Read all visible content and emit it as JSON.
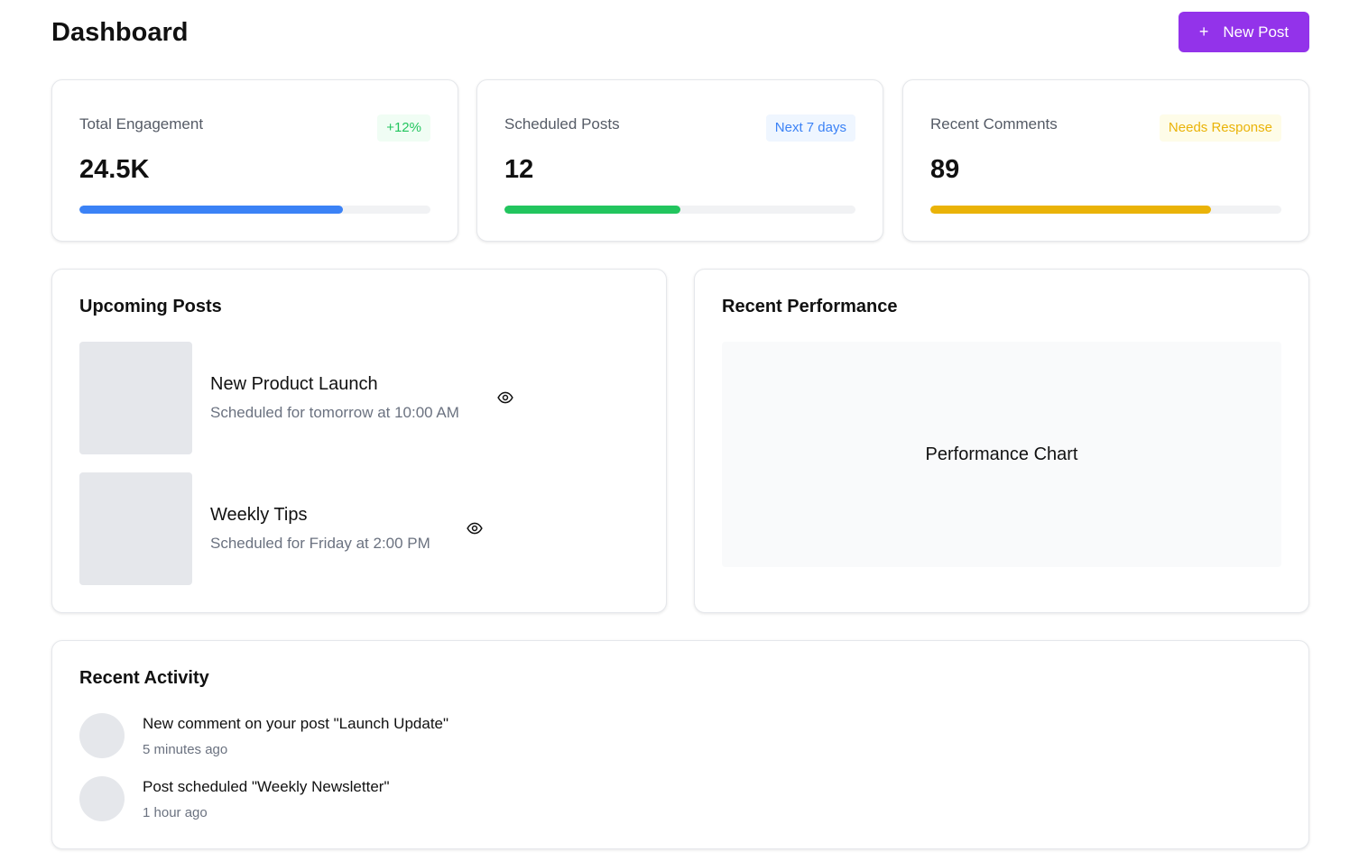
{
  "header": {
    "title": "Dashboard",
    "new_post_icon": "+",
    "new_post_label": "New Post"
  },
  "stats": [
    {
      "label": "Total Engagement",
      "badge": "+12%",
      "badge_color": "#22c55e",
      "badge_bg": "#f0fdf4",
      "value": "24.5K",
      "progress": 0.75,
      "bar_color": "#3b82f6"
    },
    {
      "label": "Scheduled Posts",
      "badge": "Next 7 days",
      "badge_color": "#3b82f6",
      "badge_bg": "#eff6ff",
      "value": "12",
      "progress": 0.5,
      "bar_color": "#22c55e"
    },
    {
      "label": "Recent Comments",
      "badge": "Needs Response",
      "badge_color": "#eab308",
      "badge_bg": "#fefce8",
      "value": "89",
      "progress": 0.8,
      "bar_color": "#eab308"
    }
  ],
  "upcoming": {
    "title": "Upcoming Posts",
    "posts": [
      {
        "title": "New Product Launch",
        "meta": "Scheduled for tomorrow at 10:00 AM",
        "icon": "eye-icon"
      },
      {
        "title": "Weekly Tips",
        "meta": "Scheduled for Friday at 2:00 PM",
        "icon": "eye-icon"
      }
    ]
  },
  "performance": {
    "title": "Recent Performance",
    "placeholder": "Performance Chart"
  },
  "activity": {
    "title": "Recent Activity",
    "items": [
      {
        "text": "New comment on your post \"Launch Update\"",
        "time": "5 minutes ago"
      },
      {
        "text": "Post scheduled \"Weekly Newsletter\"",
        "time": "1 hour ago"
      }
    ]
  }
}
